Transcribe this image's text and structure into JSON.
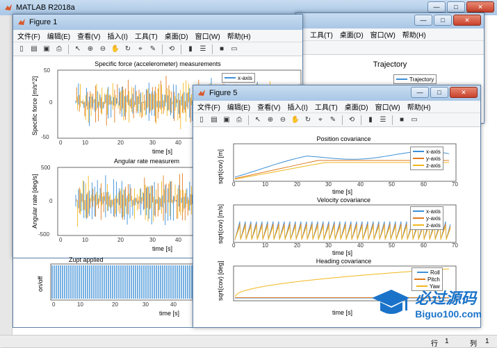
{
  "main_window": {
    "title": "MATLAB R2018a"
  },
  "menu": [
    "文件(F)",
    "编辑(E)",
    "查看(V)",
    "插入(I)",
    "工具(T)",
    "桌面(D)",
    "窗口(W)",
    "帮助(H)"
  ],
  "figure1": {
    "title": "Figure 1",
    "plot1": {
      "title": "Specific force (accelerometer) measurements",
      "ylabel": "Specific force [m/s^2]",
      "xlabel": "time [s]",
      "yticks": [
        "50",
        "0",
        "-50"
      ],
      "xticks": [
        "0",
        "10",
        "20",
        "30",
        "40"
      ],
      "legend": [
        "x-axis"
      ]
    },
    "plot2": {
      "title": "Angular rate measurem",
      "ylabel": "Angular rate  [deg/s]",
      "xlabel": "time [s]",
      "yticks": [
        "500",
        "0",
        "-500"
      ],
      "xticks": [
        "0",
        "10",
        "20",
        "30",
        "40"
      ]
    },
    "plot3": {
      "title": "Zupt applied",
      "ylabel": "on/off",
      "xlabel": "time [s]",
      "xticks": [
        "0",
        "10",
        "20",
        "30",
        "40"
      ]
    }
  },
  "figure2": {
    "plot": {
      "title": "Trajectory",
      "legend": [
        "Trajectory"
      ]
    }
  },
  "figure5": {
    "title": "Figure 5",
    "plot1": {
      "title": "Position covariance",
      "ylabel": "sqrt(cov) [m]",
      "xlabel": "time [s]",
      "xticks": [
        "0",
        "10",
        "20",
        "30",
        "40",
        "50",
        "60",
        "70"
      ],
      "legend": [
        "x-axis",
        "y-axis",
        "z-axis"
      ]
    },
    "plot2": {
      "title": "Velocity covariance",
      "ylabel": "sqrt(cov) [m/s]",
      "xlabel": "time [s]",
      "xticks": [
        "0",
        "10",
        "20",
        "30",
        "40",
        "50",
        "60",
        "70"
      ],
      "legend": [
        "x-axis",
        "y-axis",
        "z-axis"
      ]
    },
    "plot3": {
      "title": "Heading covariance",
      "ylabel": "sqrt(cov) [deg]",
      "xlabel": "time [s]",
      "xticks": [
        "0",
        "10",
        "20",
        "30",
        "40",
        "50",
        "60",
        "70"
      ],
      "legend": [
        "Roll",
        "Pitch",
        "Yaw"
      ]
    }
  },
  "status": {
    "row_label": "行",
    "row_value": "1",
    "col_label": "列",
    "col_value": "1"
  },
  "watermark": {
    "cn": "必过源码",
    "en": "Biguo100.com"
  },
  "colors": {
    "blue": "#3b8fd6",
    "orange": "#e07a1c",
    "yellow": "#f0b71c",
    "titlebar": "#a9c7e6"
  }
}
